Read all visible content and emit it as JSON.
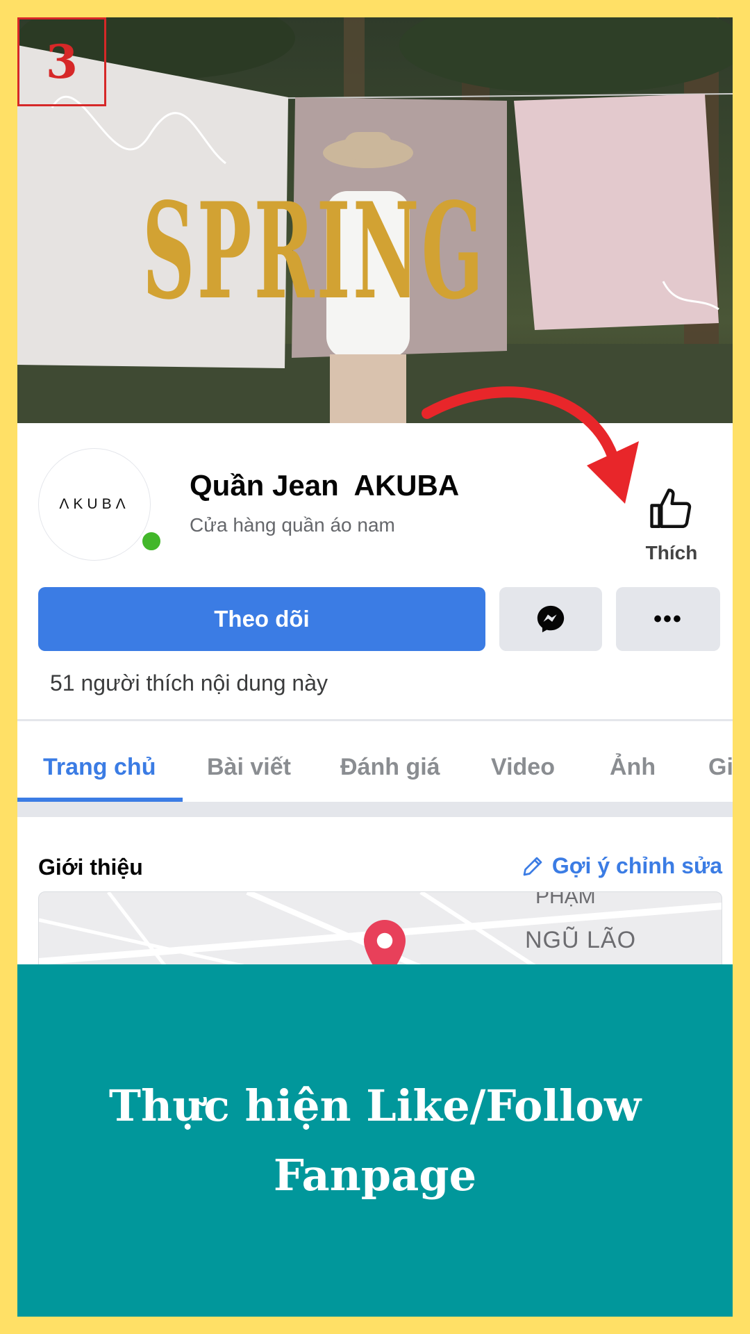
{
  "step_number": "3",
  "cover": {
    "headline": "SPRING",
    "script_left": "hello",
    "script_right": "den"
  },
  "page": {
    "avatar_text": "ΛKUBΛ",
    "name": "Quần Jean  AKUBA",
    "category": "Cửa hàng quần áo nam",
    "like_label": "Thích",
    "follow_label": "Theo dõi",
    "messenger_icon": "messenger-icon",
    "more_label": "•••",
    "likes_count": "51 người thích nội dung này"
  },
  "tabs": [
    {
      "label": "Trang chủ",
      "active": true
    },
    {
      "label": "Bài viết",
      "active": false
    },
    {
      "label": "Đánh giá",
      "active": false
    },
    {
      "label": "Video",
      "active": false
    },
    {
      "label": "Ảnh",
      "active": false
    },
    {
      "label": "Gi",
      "active": false
    }
  ],
  "intro": {
    "title": "Giới thiệu",
    "edit_label": "Gợi ý chỉnh sửa",
    "map_label_top": "PHẠM",
    "map_label": "NGŨ LÃO"
  },
  "banner": {
    "line1": "Thực hiện Like/Follow",
    "line2": "Fanpage"
  },
  "colors": {
    "border": "#FFE066",
    "accent_blue": "#3b7ce4",
    "banner_teal": "#01979b",
    "arrow_red": "#e8262a",
    "online_green": "#42b72a"
  }
}
